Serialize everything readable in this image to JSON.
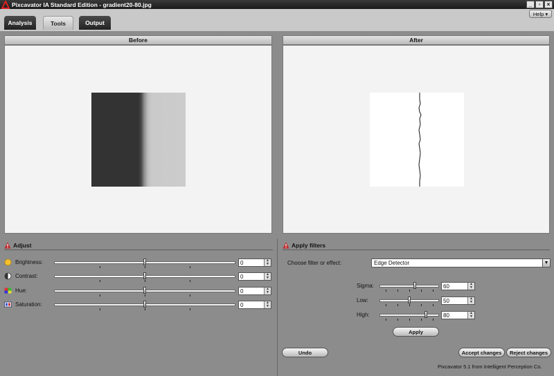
{
  "window": {
    "title": "Pixcavator IA Standard Edition - gradient20-80.jpg",
    "buttons": [
      "_",
      "▫",
      "×"
    ]
  },
  "tabs": [
    {
      "label": "Analysis",
      "active": false
    },
    {
      "label": "Tools",
      "active": true
    },
    {
      "label": "Output",
      "active": false
    }
  ],
  "help": {
    "label": "Help",
    "arrow": "▾"
  },
  "before_panel": {
    "title": "Before"
  },
  "after_panel": {
    "title": "After"
  },
  "adjust": {
    "title": "Adjust",
    "rows": [
      {
        "label": "Brightness:",
        "value": "0",
        "fraction": 0.5,
        "icon": "sun-icon"
      },
      {
        "label": "Contrast:",
        "value": "0",
        "fraction": 0.5,
        "icon": "contrast-icon"
      },
      {
        "label": "Hue:",
        "value": "0",
        "fraction": 0.5,
        "icon": "hue-icon"
      },
      {
        "label": "Saturation:",
        "value": "0",
        "fraction": 0.5,
        "icon": "saturation-icon"
      }
    ]
  },
  "filters": {
    "title": "Apply filters",
    "choose_label": "Choose filter or effect:",
    "selected": "Edge Detector",
    "params": [
      {
        "label": "Sigma:",
        "value": "60",
        "fraction": 0.6
      },
      {
        "label": "Low:",
        "value": "50",
        "fraction": 0.5
      },
      {
        "label": "High:",
        "value": "80",
        "fraction": 0.8
      }
    ],
    "apply_label": "Apply"
  },
  "buttons": {
    "undo": "Undo",
    "accept": "Accept changes",
    "reject": "Reject changes"
  },
  "footer": "Pixcavator 5.1 from Intelligent Perception Co.",
  "colors": {
    "accent_red": "#c0282d",
    "background": "#8c8c8c",
    "panel": "#f3f3f3"
  },
  "spin_arrows": {
    "up": "▲",
    "down": "▼"
  },
  "select_arrow": "▼"
}
